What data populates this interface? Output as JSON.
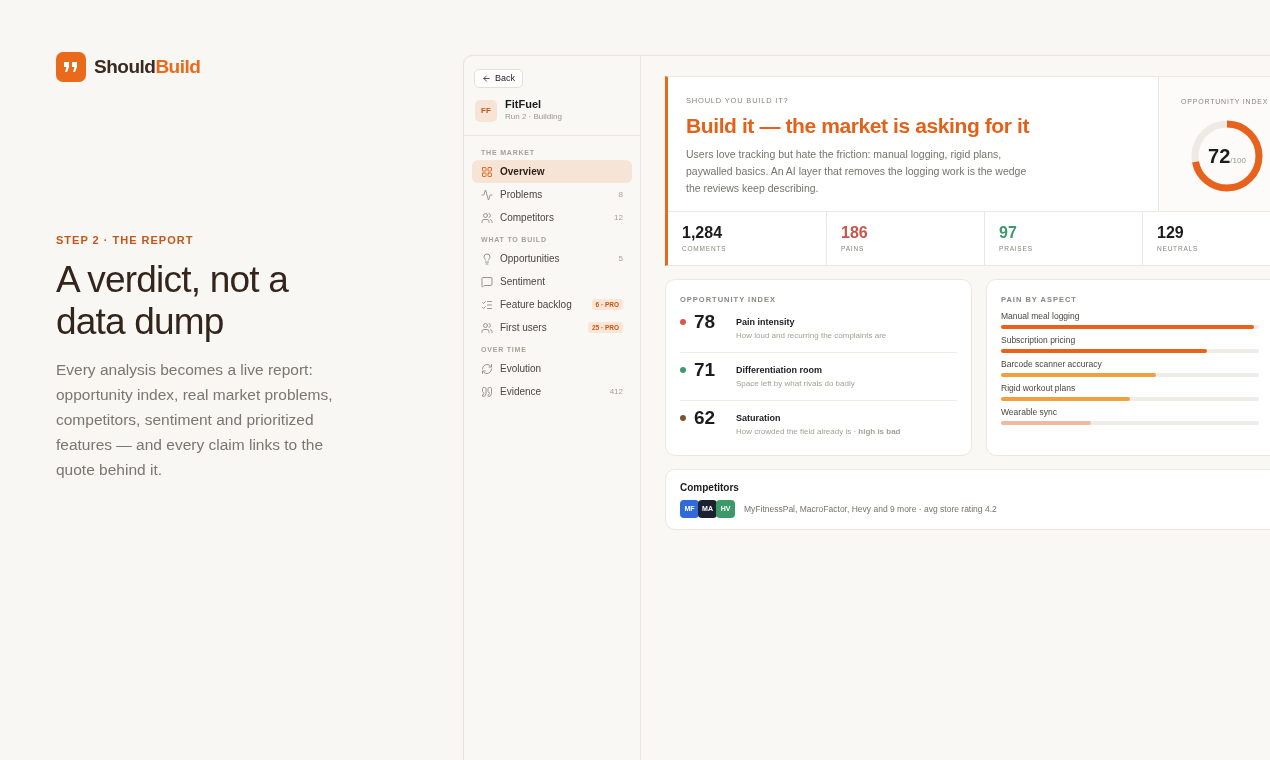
{
  "brand": {
    "parts": [
      "Should",
      "Build"
    ]
  },
  "intro": {
    "eyebrow": "STEP 2 · THE REPORT",
    "headline": "A verdict, not a data dump",
    "body": "Every analysis becomes a live report: opportunity index, real market problems, competitors, sentiment and prioritized features — and every claim links to the quote behind it."
  },
  "sidebar": {
    "back": "Back",
    "project": {
      "initials": "FF",
      "name": "FitFuel",
      "meta": "Run 2 · Building"
    },
    "sections": [
      {
        "title": "THE MARKET",
        "items": [
          {
            "label": "Overview",
            "selected": true
          },
          {
            "label": "Problems",
            "badge": "8",
            "kind": "count",
            "selected": false
          },
          {
            "label": "Competitors",
            "badge": "12",
            "kind": "count",
            "selected": false
          }
        ]
      },
      {
        "title": "WHAT TO BUILD",
        "items": [
          {
            "label": "Opportunities",
            "badge": "5",
            "kind": "count",
            "selected": false
          },
          {
            "label": "Sentiment",
            "selected": false
          },
          {
            "label": "Feature backlog",
            "badge": "6 · PRO",
            "kind": "pro",
            "selected": false
          },
          {
            "label": "First users",
            "badge": "25 · PRO",
            "kind": "pro",
            "selected": false
          }
        ]
      },
      {
        "title": "OVER TIME",
        "items": [
          {
            "label": "Evolution",
            "selected": false
          },
          {
            "label": "Evidence",
            "badge": "412",
            "kind": "count",
            "selected": false
          }
        ]
      }
    ]
  },
  "verdict": {
    "eyebrow": "SHOULD YOU BUILD IT?",
    "title": "Build it — the market is asking for it",
    "body": "Users love tracking but hate the friction: manual logging, rigid plans, paywalled basics. An AI layer that removes the logging work is the wedge the reviews keep describing.",
    "index_label": "OPPORTUNITY INDEX",
    "score": "72",
    "score_max": "/100",
    "level": 0.72
  },
  "stats": [
    {
      "value": "1,284",
      "label": "COMMENTS",
      "color": "#1c1c1c"
    },
    {
      "value": "186",
      "label": "PAINS",
      "color": "#c8554a"
    },
    {
      "value": "97",
      "label": "PRAISES",
      "color": "#3d9a6e"
    },
    {
      "value": "129",
      "label": "NEUTRALS",
      "color": "#1c1c1c"
    }
  ],
  "opportunity": {
    "title": "OPPORTUNITY INDEX",
    "rows": [
      {
        "value": "78",
        "name": "Pain intensity",
        "note": "How loud and recurring the complaints are",
        "color": "#d9574e"
      },
      {
        "value": "71",
        "name": "Differentiation room",
        "note": "Space left by what rivals do badly",
        "color": "#3d9a6e"
      },
      {
        "value": "62",
        "name": "Saturation",
        "note": "How crowded the field already is · **high is bad**",
        "color": "#7a5535"
      }
    ]
  },
  "pain": {
    "title": "PAIN BY ASPECT",
    "rows": [
      {
        "label": "Manual meal logging",
        "level": 0.98,
        "color": "#e8621c"
      },
      {
        "label": "Subscription pricing",
        "level": 0.8,
        "color": "#e8621c"
      },
      {
        "label": "Barcode scanner accuracy",
        "level": 0.6,
        "color": "#f0a03c"
      },
      {
        "label": "Rigid workout plans",
        "level": 0.5,
        "color": "#f0a03c"
      },
      {
        "label": "Wearable sync",
        "level": 0.35,
        "color": "#f1b9a0"
      }
    ]
  },
  "competitors": {
    "title": "Competitors",
    "avatars": [
      {
        "initials": "MF",
        "color": "#2f6ad8"
      },
      {
        "initials": "MA",
        "color": "#1b2130"
      },
      {
        "initials": "HV",
        "color": "#3c9a68"
      }
    ],
    "summary": "MyFitnessPal, MacroFactor, Hevy and 9 more · avg store rating 4.2"
  }
}
